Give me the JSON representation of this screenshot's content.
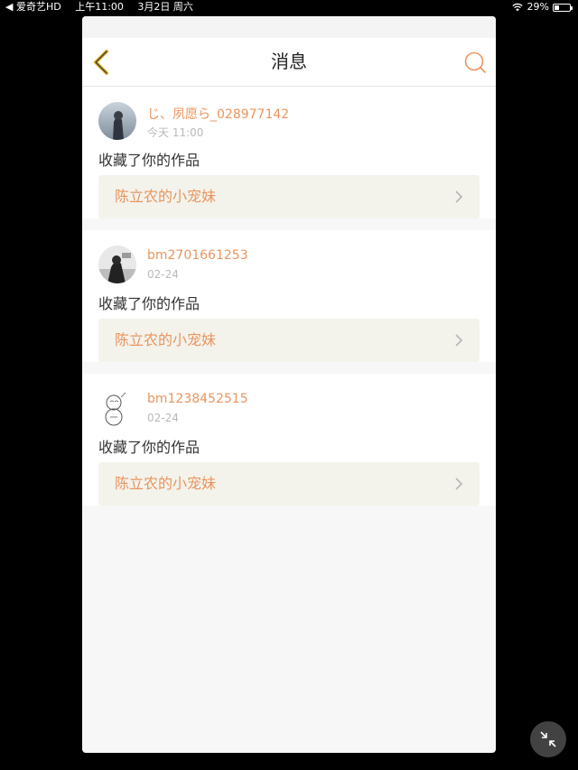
{
  "status_bar": {
    "back_app": "◀ 爱奇艺HD",
    "time": "上午11:00",
    "date": "3月2日 周六",
    "battery_percent": "29%",
    "battery_level": 0.29
  },
  "header": {
    "title": "消息"
  },
  "messages": [
    {
      "username": "じ、夙愿ら_028977142",
      "time": "今天 11:00",
      "action": "收藏了你的作品",
      "work_title": "陈立农的小宠妹"
    },
    {
      "username": "bm2701661253",
      "time": "02-24",
      "action": "收藏了你的作品",
      "work_title": "陈立农的小宠妹"
    },
    {
      "username": "bm1238452515",
      "time": "02-24",
      "action": "收藏了你的作品",
      "work_title": "陈立农的小宠妹"
    }
  ],
  "colors": {
    "accent": "#e9955e",
    "back_icon": "#e6b422",
    "link_bg": "#f3f3ec"
  },
  "icons": {
    "back": "chevron-left-icon",
    "search": "search-icon",
    "item_arrow": "chevron-right-icon",
    "floating": "collapse-icon"
  }
}
